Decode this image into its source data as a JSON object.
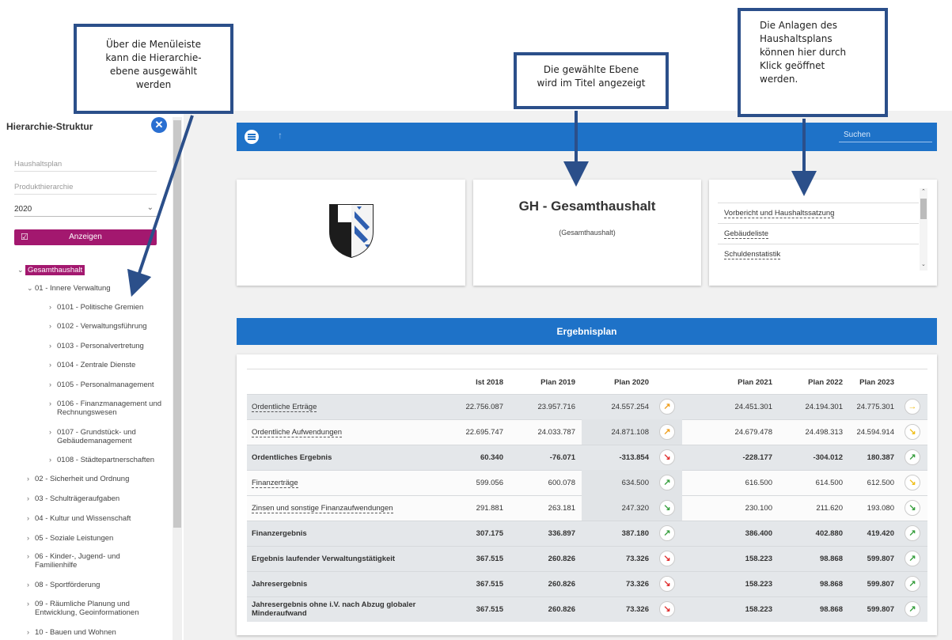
{
  "sidebar": {
    "title": "Hierarchie-Struktur",
    "field_plan": "Haushaltsplan",
    "field_product": "Produkthierarchie",
    "year": "2020",
    "button_label": "Anzeigen",
    "root": "Gesamthaushalt",
    "items": [
      {
        "label": "01 - Innere Verwaltung",
        "arrow": "⌄"
      },
      {
        "label": "0101 - Politische Gremien",
        "arrow": "›"
      },
      {
        "label": "0102 - Verwaltungsführung",
        "arrow": "›"
      },
      {
        "label": "0103 - Personalvertretung",
        "arrow": "›"
      },
      {
        "label": "0104 - Zentrale Dienste",
        "arrow": "›"
      },
      {
        "label": "0105 - Personalmanagement",
        "arrow": "›"
      },
      {
        "label": "0106 - Finanzmanagement und",
        "label2": "Rechnungswesen",
        "arrow": "›"
      },
      {
        "label": "0107 - Grundstück- und",
        "label2": "Gebäudemanagement",
        "arrow": "›"
      },
      {
        "label": "0108 - Städtepartnerschaften",
        "arrow": "›"
      },
      {
        "label": "02 - Sicherheit und Ordnung",
        "arrow": "›"
      },
      {
        "label": "03 - Schulträgeraufgaben",
        "arrow": "›"
      },
      {
        "label": "04 - Kultur und Wissenschaft",
        "arrow": "›"
      },
      {
        "label": "05 - Soziale Leistungen",
        "arrow": "›"
      },
      {
        "label": "06 - Kinder-, Jugend- und",
        "label2": "Familienhilfe",
        "arrow": "›"
      },
      {
        "label": "08 - Sportförderung",
        "arrow": "›"
      },
      {
        "label": "09 - Räumliche Planung und",
        "label2": "Entwicklung, Geoinformationen",
        "arrow": "›"
      },
      {
        "label": "10 - Bauen und Wohnen",
        "arrow": "›"
      }
    ]
  },
  "topbar": {
    "search_label": "Suchen",
    "up_icon": "↑"
  },
  "header_card": {
    "title": "GH - Gesamthaushalt",
    "subtitle": "(Gesamthaushalt)"
  },
  "annexes": [
    "Vorbericht und Haushaltssatzung",
    "Gebäudeliste",
    "Schuldenstatistik"
  ],
  "plan": {
    "title": "Ergebnisplan",
    "columns": [
      "Ist 2018",
      "Plan 2019",
      "Plan 2020",
      "Plan 2021",
      "Plan 2022",
      "Plan 2023"
    ],
    "rows": [
      {
        "label": "Ordentliche Erträge",
        "link": true,
        "bold": false,
        "shade": true,
        "values": [
          "22.756.087",
          "23.957.716",
          "24.557.254",
          "24.451.301",
          "24.194.301",
          "24.775.301"
        ],
        "trend2020": "↗",
        "trend2020color": "#f0a020",
        "trend2023": "→",
        "trend2023color": "#f0c020"
      },
      {
        "label": "Ordentliche Aufwendungen",
        "link": true,
        "bold": false,
        "shade": false,
        "values": [
          "22.695.747",
          "24.033.787",
          "24.871.108",
          "24.679.478",
          "24.498.313",
          "24.594.914"
        ],
        "trend2020": "↗",
        "trend2020color": "#f0a020",
        "trend2023": "↘",
        "trend2023color": "#f0c020"
      },
      {
        "label": "Ordentliches Ergebnis",
        "link": false,
        "bold": true,
        "shade": true,
        "values": [
          "60.340",
          "-76.071",
          "-313.854",
          "-228.177",
          "-304.012",
          "180.387"
        ],
        "trend2020": "↘",
        "trend2020color": "#e03030",
        "trend2023": "↗",
        "trend2023color": "#3aa040"
      },
      {
        "label": "Finanzerträge",
        "link": true,
        "bold": false,
        "shade": false,
        "values": [
          "599.056",
          "600.078",
          "634.500",
          "616.500",
          "614.500",
          "612.500"
        ],
        "trend2020": "↗",
        "trend2020color": "#3aa040",
        "trend2023": "↘",
        "trend2023color": "#f0c020"
      },
      {
        "label": "Zinsen und sonstige Finanzaufwendungen",
        "link": true,
        "bold": false,
        "shade": false,
        "values": [
          "291.881",
          "263.181",
          "247.320",
          "230.100",
          "211.620",
          "193.080"
        ],
        "trend2020": "↘",
        "trend2020color": "#3aa040",
        "trend2023": "↘",
        "trend2023color": "#3aa040"
      },
      {
        "label": "Finanzergebnis",
        "link": false,
        "bold": true,
        "shade": true,
        "values": [
          "307.175",
          "336.897",
          "387.180",
          "386.400",
          "402.880",
          "419.420"
        ],
        "trend2020": "↗",
        "trend2020color": "#3aa040",
        "trend2023": "↗",
        "trend2023color": "#3aa040"
      },
      {
        "label": "Ergebnis laufender Verwaltungstätigkeit",
        "link": false,
        "bold": true,
        "shade": true,
        "values": [
          "367.515",
          "260.826",
          "73.326",
          "158.223",
          "98.868",
          "599.807"
        ],
        "trend2020": "↘",
        "trend2020color": "#e03030",
        "trend2023": "↗",
        "trend2023color": "#3aa040"
      },
      {
        "label": "Jahresergebnis",
        "link": false,
        "bold": true,
        "shade": true,
        "values": [
          "367.515",
          "260.826",
          "73.326",
          "158.223",
          "98.868",
          "599.807"
        ],
        "trend2020": "↘",
        "trend2020color": "#e03030",
        "trend2023": "↗",
        "trend2023color": "#3aa040"
      },
      {
        "label": "Jahresergebnis ohne i.V. nach Abzug globaler",
        "label2": "Minderaufwand",
        "link": false,
        "bold": true,
        "shade": true,
        "values": [
          "367.515",
          "260.826",
          "73.326",
          "158.223",
          "98.868",
          "599.807"
        ],
        "trend2020": "↘",
        "trend2020color": "#e03030",
        "trend2023": "↗",
        "trend2023color": "#3aa040"
      }
    ]
  },
  "callouts": {
    "menu": [
      "Über die Menüleiste",
      "kann die Hierarchie-",
      "ebene ausgewählt",
      "werden"
    ],
    "title": [
      "Die gewählte Ebene",
      "wird im Titel angezeigt"
    ],
    "annex": [
      "Die Anlagen des",
      "Haushaltsplans",
      "können hier durch",
      "Klick geöffnet",
      "werden."
    ]
  },
  "colors": {
    "primary": "#1e72c8",
    "accent": "#a3186f",
    "callout_border": "#2b4f8a"
  }
}
